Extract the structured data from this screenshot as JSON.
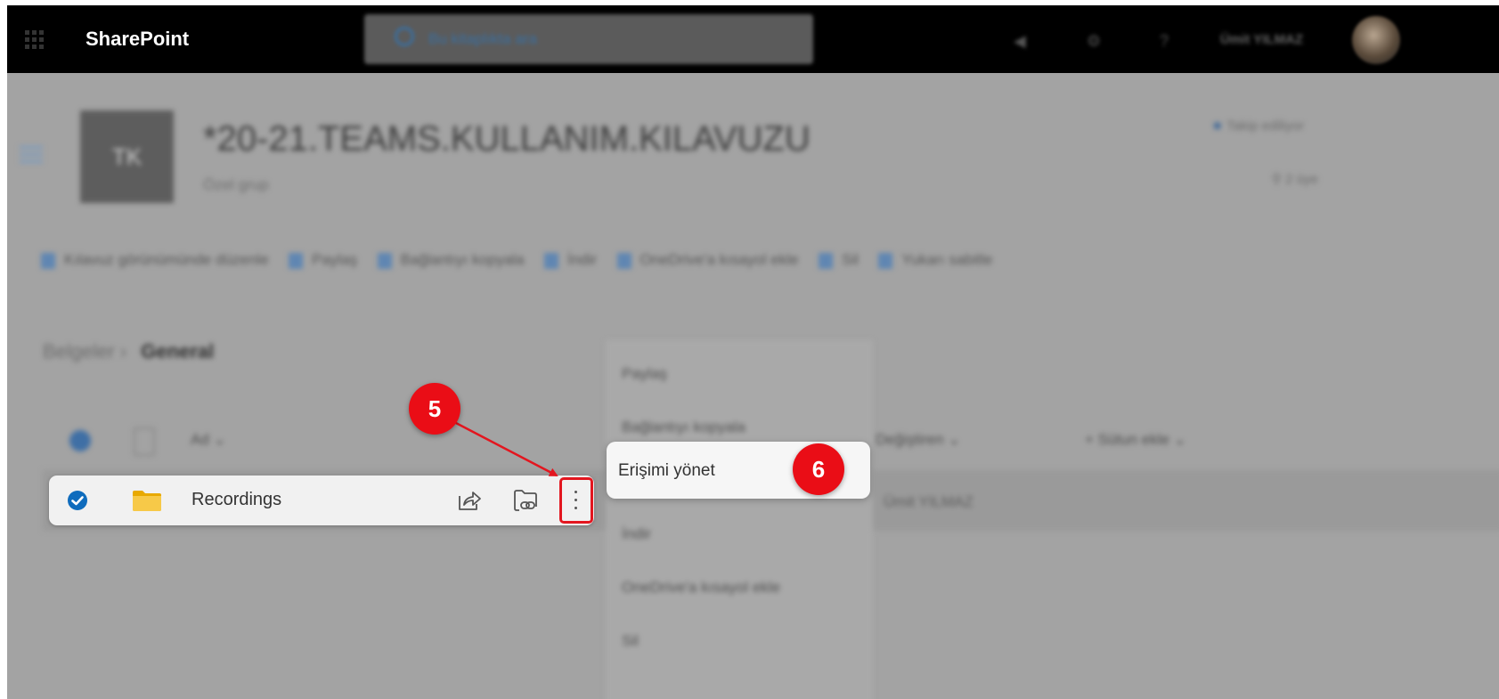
{
  "topbar": {
    "brand": "SharePoint",
    "search_placeholder": "Bu kitaplıkta ara",
    "user_name": "Ümit YILMAZ"
  },
  "site": {
    "logo_initials": "TK",
    "title": "*20-21.TEAMS.KULLANIM.KILAVUZU",
    "subtitle": "Özel grup",
    "follow_label": "Takip ediliyor",
    "members_label": "2 üye"
  },
  "command_bar": [
    "Kılavuz görünümünde düzenle",
    "Paylaş",
    "Bağlantıyı kopyala",
    "İndir",
    "OneDrive'a kısayol ekle",
    "Sil",
    "Yukarı sabitle"
  ],
  "breadcrumb": {
    "root": "Belgeler",
    "current": "General"
  },
  "list": {
    "columns": {
      "name": "Ad",
      "modified_by": "Değiştiren",
      "add_column": "Sütun ekle"
    },
    "rows": [
      {
        "name": "Recordings",
        "modified_by": "Ümit YILMAZ",
        "selected": true
      }
    ]
  },
  "context_menu": {
    "items": [
      "Paylaş",
      "Bağlantıyı kopyala",
      "Erişimi yönet",
      "İndir",
      "OneDrive'a kısayol ekle",
      "Sil"
    ],
    "highlighted": "Erişimi yönet"
  },
  "annotations": {
    "step_a": "5",
    "step_b": "6",
    "color": "#ea0d16"
  },
  "colors": {
    "accent": "#0f6cbd",
    "folder": "#f7c948",
    "highlight": "#e3161f"
  }
}
